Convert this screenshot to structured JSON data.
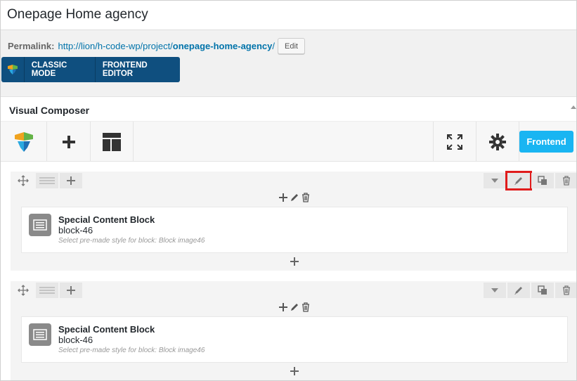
{
  "page": {
    "title": "Onepage Home agency"
  },
  "permalink": {
    "label": "Permalink:",
    "url_base": "http://lion/h-code-wp/project/",
    "slug": "onepage-home-agency",
    "url_tail": "/",
    "edit_label": "Edit"
  },
  "modebar": {
    "classic_label": "CLASSIC MODE",
    "frontend_editor_label": "FRONTEND EDITOR"
  },
  "vc": {
    "title": "Visual Composer",
    "frontend_button": "Frontend"
  },
  "rows": [
    {
      "element": {
        "title": "Special Content Block",
        "subtitle": "block-46",
        "description": "Select pre-made style for block: Block image46"
      }
    },
    {
      "element": {
        "title": "Special Content Block",
        "subtitle": "block-46",
        "description": "Select pre-made style for block: Block image46"
      }
    }
  ],
  "colors": {
    "accent_blue": "#19b5f2",
    "modebar_blue": "#0f4f7f",
    "highlight_red": "#e01b1b",
    "link_blue": "#0073aa"
  }
}
